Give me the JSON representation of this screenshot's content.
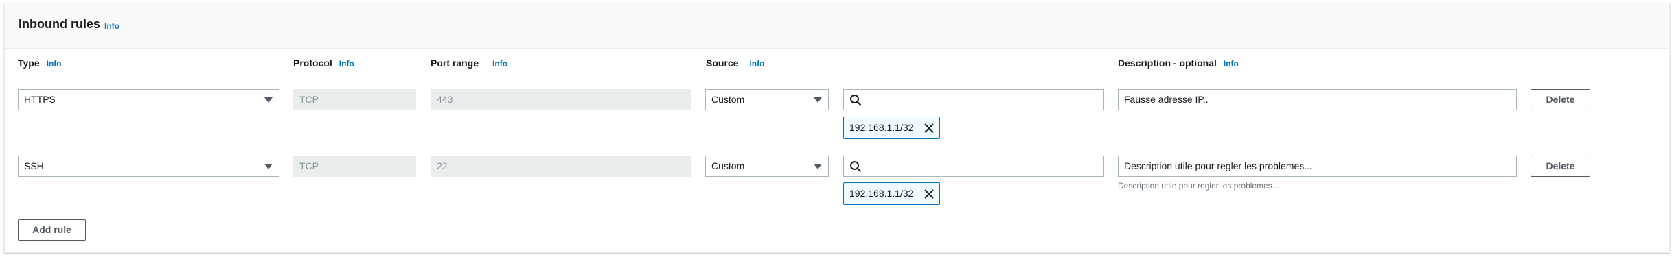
{
  "section": {
    "title": "Inbound rules",
    "info": "Info"
  },
  "columns": {
    "type": "Type",
    "protocol": "Protocol",
    "port_range": "Port range",
    "source": "Source",
    "description": "Description - optional",
    "info": "Info"
  },
  "rules": [
    {
      "type": "HTTPS",
      "protocol": "TCP",
      "port_range": "443",
      "source_type": "Custom",
      "source_search": "",
      "source_token": "192.168.1.1/32",
      "description": "Fausse adresse IP..",
      "description_hint": "",
      "delete_label": "Delete"
    },
    {
      "type": "SSH",
      "protocol": "TCP",
      "port_range": "22",
      "source_type": "Custom",
      "source_search": "",
      "source_token": "192.168.1.1/32",
      "description": "Description utile pour regler les problemes...",
      "description_hint": "Description utile pour regler les problemes...",
      "delete_label": "Delete"
    }
  ],
  "add_rule_label": "Add rule",
  "icons": {
    "caret": "caret-down-icon",
    "search": "search-icon",
    "remove": "close-icon"
  },
  "colors": {
    "link": "#0073bb",
    "border": "#aab7b8",
    "disabled_bg": "#eaeded",
    "token_border": "#0073bb",
    "token_bg": "#f1faff"
  }
}
